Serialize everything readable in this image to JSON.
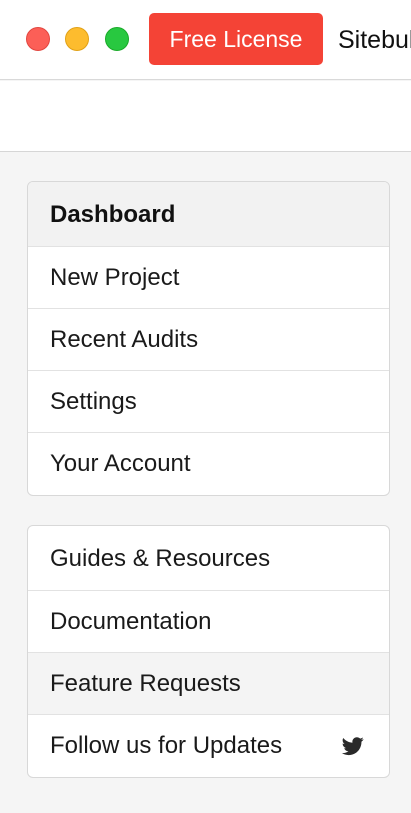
{
  "window": {
    "license_button": "Free License",
    "title": "Sitebulb"
  },
  "nav_primary": {
    "items": [
      {
        "label": "Dashboard",
        "active": true
      },
      {
        "label": "New Project"
      },
      {
        "label": "Recent Audits"
      },
      {
        "label": "Settings"
      },
      {
        "label": "Your Account"
      }
    ]
  },
  "nav_secondary": {
    "items": [
      {
        "label": "Guides & Resources"
      },
      {
        "label": "Documentation"
      },
      {
        "label": "Feature Requests",
        "highlighted": true
      },
      {
        "label": "Follow us for Updates",
        "icon": "twitter-icon"
      }
    ]
  },
  "colors": {
    "license_button": "#f44336",
    "close": "#fc5f57",
    "minimize": "#fdbc2e",
    "zoom": "#28c840"
  }
}
